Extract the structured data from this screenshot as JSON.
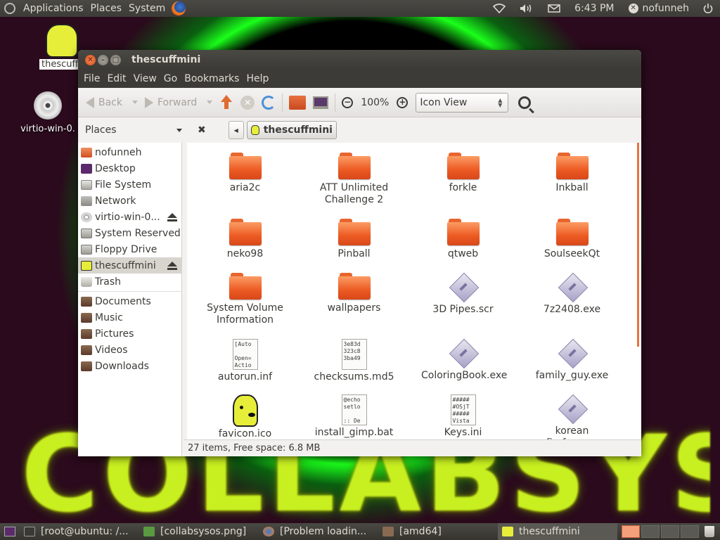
{
  "top_panel": {
    "menus": [
      "Applications",
      "Places",
      "System"
    ],
    "time": "6:43 PM",
    "user": "nofunneh"
  },
  "desktop_icons": [
    {
      "label": "thescuffm"
    },
    {
      "label": "virtio-win-0."
    }
  ],
  "window": {
    "title": "thescuffmini",
    "menus": [
      "File",
      "Edit",
      "View",
      "Go",
      "Bookmarks",
      "Help"
    ],
    "toolbar": {
      "back_label": "Back",
      "forward_label": "Forward",
      "zoom_level": "100%",
      "view_mode": "Icon View"
    },
    "places_label": "Places",
    "breadcrumb": "thescuffmini",
    "sidebar": {
      "devices": [
        {
          "label": "nofunneh",
          "icon": "home-folder-icon"
        },
        {
          "label": "Desktop",
          "icon": "desktop-icon"
        },
        {
          "label": "File System",
          "icon": "filesystem-icon"
        },
        {
          "label": "Network",
          "icon": "network-icon"
        },
        {
          "label": "virtio-win-0...",
          "icon": "cdrom-icon",
          "eject": true
        },
        {
          "label": "System Reserved",
          "icon": "drive-icon"
        },
        {
          "label": "Floppy Drive",
          "icon": "floppy-icon"
        },
        {
          "label": "thescuffmini",
          "icon": "drive-icon",
          "eject": true,
          "selected": true
        },
        {
          "label": "Trash",
          "icon": "trash-icon"
        }
      ],
      "bookmarks": [
        {
          "label": "Documents",
          "icon": "folder-icon"
        },
        {
          "label": "Music",
          "icon": "folder-icon"
        },
        {
          "label": "Pictures",
          "icon": "folder-icon"
        },
        {
          "label": "Videos",
          "icon": "folder-icon"
        },
        {
          "label": "Downloads",
          "icon": "folder-icon"
        }
      ]
    },
    "files": [
      {
        "name": "aria2c",
        "type": "folder"
      },
      {
        "name": "ATT Unlimited Challenge 2",
        "type": "folder"
      },
      {
        "name": "forkle",
        "type": "folder"
      },
      {
        "name": "Inkball",
        "type": "folder"
      },
      {
        "name": "neko98",
        "type": "folder"
      },
      {
        "name": "Pinball",
        "type": "folder"
      },
      {
        "name": "qtweb",
        "type": "folder"
      },
      {
        "name": "SoulseekQt",
        "type": "folder"
      },
      {
        "name": "System Volume Information",
        "type": "folder"
      },
      {
        "name": "wallpapers",
        "type": "folder"
      },
      {
        "name": "3D Pipes.scr",
        "type": "exe"
      },
      {
        "name": "7z2408.exe",
        "type": "exe"
      },
      {
        "name": "autorun.inf",
        "type": "text",
        "preview": "[Auto\n\nOpen=\nActio"
      },
      {
        "name": "checksums.md5",
        "type": "text",
        "preview": "3e83d\n323c8\n3ba49"
      },
      {
        "name": "ColoringBook.exe",
        "type": "exe"
      },
      {
        "name": "family_guy.exe",
        "type": "exe"
      },
      {
        "name": "favicon.ico",
        "type": "image"
      },
      {
        "name": "install_gimp.bat",
        "type": "text",
        "preview": "@echo\nsetlo\n\n:: De"
      },
      {
        "name": "Keys.ini",
        "type": "text",
        "preview": "#####\n#OSjT\n#####\nVista"
      },
      {
        "name": "korean firefox.exe",
        "type": "exe"
      }
    ],
    "status": "27 items, Free space: 6.8 MB"
  },
  "taskbar": [
    {
      "label": "[root@ubuntu: /...",
      "icon": "terminal-icon"
    },
    {
      "label": "[collabsysos.png]",
      "icon": "image-viewer-icon"
    },
    {
      "label": "[Problem loadin...",
      "icon": "firefox-icon"
    },
    {
      "label": "[amd64]",
      "icon": "folder-icon"
    },
    {
      "label": "thescuffmini",
      "icon": "drive-icon",
      "active": true
    }
  ],
  "wallpaper_text": "COLLABSYSOS"
}
